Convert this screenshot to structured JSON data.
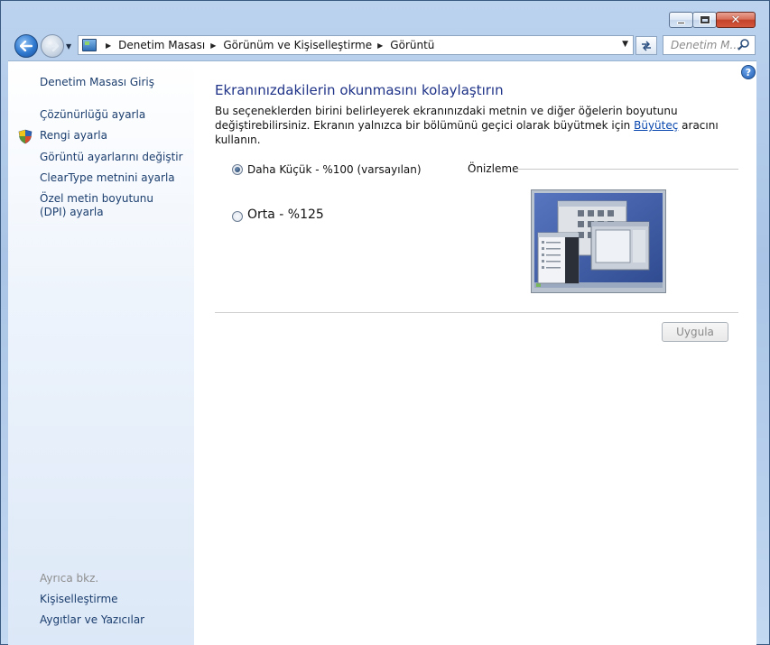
{
  "window": {
    "controls": {
      "minimize_icon": "minimize-icon",
      "maximize_icon": "maximize-icon",
      "close_glyph": "✕"
    }
  },
  "nav": {
    "breadcrumbs": [
      "Denetim Masası",
      "Görünüm ve Kişiselleştirme",
      "Görüntü"
    ],
    "search_placeholder": "Denetim M..."
  },
  "sidebar": {
    "home": "Denetim Masası Giriş",
    "tasks": [
      {
        "label": "Çözünürlüğü ayarla",
        "icon": null
      },
      {
        "label": "Rengi ayarla",
        "icon": "shield-icon"
      },
      {
        "label": "Görüntü ayarlarını değiştir",
        "icon": null
      },
      {
        "label": "ClearType metnini ayarla",
        "icon": null
      },
      {
        "label": "Özel metin boyutunu (DPI) ayarla",
        "icon": null
      }
    ],
    "see_also_heading": "Ayrıca bkz.",
    "see_also": [
      "Kişiselleştirme",
      "Aygıtlar ve Yazıcılar"
    ]
  },
  "main": {
    "title": "Ekranınızdakilerin okunmasını kolaylaştırın",
    "intro_before_link": "Bu seçeneklerden birini belirleyerek ekranınızdaki metnin ve diğer öğelerin boyutunu değiştirebilirsiniz. Ekranın yalnızca bir bölümünü geçici olarak büyütmek için ",
    "intro_link": "Büyüteç",
    "intro_after_link": " aracını kullanın.",
    "options": [
      {
        "label": "Daha Küçük - %100 (varsayılan)",
        "checked": true
      },
      {
        "label": "Orta - %125",
        "checked": false
      }
    ],
    "preview_label": "Önizleme",
    "apply_label": "Uygula",
    "apply_enabled": false
  },
  "colors": {
    "title_blue": "#1e3287",
    "link_blue": "#1b3e6e",
    "close_red": "#c3422a"
  }
}
